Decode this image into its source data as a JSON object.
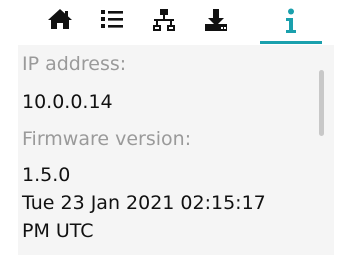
{
  "tabs": [
    {
      "icon": "home-icon",
      "active": false
    },
    {
      "icon": "list-icon",
      "active": false
    },
    {
      "icon": "network-icon",
      "active": false
    },
    {
      "icon": "download-icon",
      "active": false
    },
    {
      "icon": "info-icon",
      "active": true
    }
  ],
  "colors": {
    "accent": "#1aa0ad",
    "label": "#9a9a9a",
    "text": "#111111",
    "panel_bg": "#f5f5f5",
    "scrollbar": "#c8c8c8"
  },
  "info": {
    "ip_label": "IP address:",
    "ip_value": "10.0.0.14",
    "firmware_label": "Firmware version:",
    "firmware_value": "1.5.0",
    "date_line1": "Tue 23 Jan 2021 02:15:17",
    "date_line2": "PM UTC"
  }
}
